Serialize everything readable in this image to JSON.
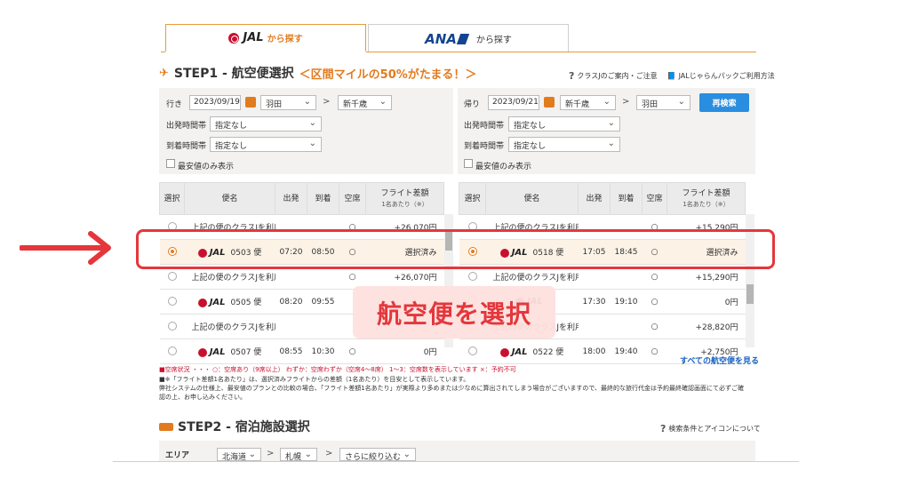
{
  "tabs": {
    "jal": {
      "logo": "JAL",
      "label": "から探す"
    },
    "ana": {
      "logo": "ANA",
      "label": "から探す"
    }
  },
  "step1": {
    "title": "STEP1 - 航空便選択",
    "subtitle": "＜区間マイルの50%がたまる！＞",
    "help1": "クラスJのご案内・ご注意",
    "help2": "JALじゃらんパックご利用方法"
  },
  "outbound": {
    "label": "行き",
    "date": "2023/09/19",
    "from": "羽田",
    "to": "新千歳",
    "time_label": "出発時間帯",
    "time_value": "指定なし",
    "arr_label": "到着時間帯",
    "arr_value": "指定なし",
    "cheapest_label": "最安値のみ表示"
  },
  "inbound": {
    "label": "帰り",
    "date": "2023/09/21",
    "from": "新千歳",
    "to": "羽田",
    "time_label": "出発時間帯",
    "time_value": "指定なし",
    "arr_label": "到着時間帯",
    "arr_value": "指定なし",
    "cheapest_label": "最安値のみ表示",
    "search_button": "再検索"
  },
  "table_headers": {
    "select": "選択",
    "flight": "便名",
    "depart": "出発",
    "arrive": "到着",
    "seats": "空席",
    "fare": "フライト差額",
    "fare_sub": "1名あたり（※）"
  },
  "outbound_rows": [
    {
      "flight": "上記の便のクラスJを利用する",
      "depart": "",
      "arrive": "",
      "seats": "○",
      "fare": "+26,070円",
      "selected": false,
      "classj": true
    },
    {
      "flight": "0503 便",
      "depart": "07:20",
      "arrive": "08:50",
      "seats": "○",
      "fare": "選択済み",
      "selected": true,
      "classj": false
    },
    {
      "flight": "上記の便のクラスJを利用する",
      "depart": "",
      "arrive": "",
      "seats": "○",
      "fare": "+26,070円",
      "selected": false,
      "classj": true
    },
    {
      "flight": "0505 便",
      "depart": "08:20",
      "arrive": "09:55",
      "seats": "",
      "fare": "",
      "selected": false,
      "classj": false
    },
    {
      "flight": "上記の便のクラスJを利用する",
      "depart": "",
      "arrive": "",
      "seats": "",
      "fare": "",
      "selected": false,
      "classj": true
    },
    {
      "flight": "0507 便",
      "depart": "08:55",
      "arrive": "10:30",
      "seats": "○",
      "fare": "0円",
      "selected": false,
      "classj": false
    }
  ],
  "inbound_rows": [
    {
      "flight": "上記の便のクラスJを利用する",
      "depart": "",
      "arrive": "",
      "seats": "○",
      "fare": "+15,290円",
      "selected": false,
      "classj": true
    },
    {
      "flight": "0518 便",
      "depart": "17:05",
      "arrive": "18:45",
      "seats": "○",
      "fare": "選択済み",
      "selected": true,
      "classj": false
    },
    {
      "flight": "上記の便のクラスJを利用する",
      "depart": "",
      "arrive": "",
      "seats": "○",
      "fare": "+15,290円",
      "selected": false,
      "classj": true
    },
    {
      "flight": "",
      "depart": "17:30",
      "arrive": "19:10",
      "seats": "○",
      "fare": "0円",
      "selected": false,
      "classj": false
    },
    {
      "flight": "上記の便のクラスJを利用する",
      "depart": "",
      "arrive": "",
      "seats": "○",
      "fare": "+28,820円",
      "selected": false,
      "classj": true
    },
    {
      "flight": "0522 便",
      "depart": "18:00",
      "arrive": "19:40",
      "seats": "○",
      "fare": "+2,750円",
      "selected": false,
      "classj": false
    }
  ],
  "notes": {
    "seat_status": "■空席状況 ・・・ ○：空席あり（9席以上） わずか：空席わずか（空席4〜8席） 1〜3：空席数を表示しています ×：予約不可",
    "fare_note1": "■※「フライト差額1名あたり」は、選択済みフライトからの差額（1名あたり）を目安として表示しています。",
    "fare_note2": "弊社システムの仕様上、最安値のプランとの比較の場合、「フライト差額1名あたり」が実際より多めまたは少なめに算出されてしまう場合がございますので、最終的な旅行代金は予約最終確認画面にて必ずご確",
    "fare_note3": "認の上、お申し込みください。",
    "all_flights_link": "すべての航空便を見る"
  },
  "step2": {
    "title": "STEP2 - 宿泊施設選択",
    "help": "検索条件とアイコンについて",
    "area_label": "エリア",
    "area1": "北海道",
    "area2": "札幌",
    "area3": "さらに絞り込む"
  },
  "annotation": {
    "label": "航空便を選択",
    "color": "#e4373c"
  }
}
